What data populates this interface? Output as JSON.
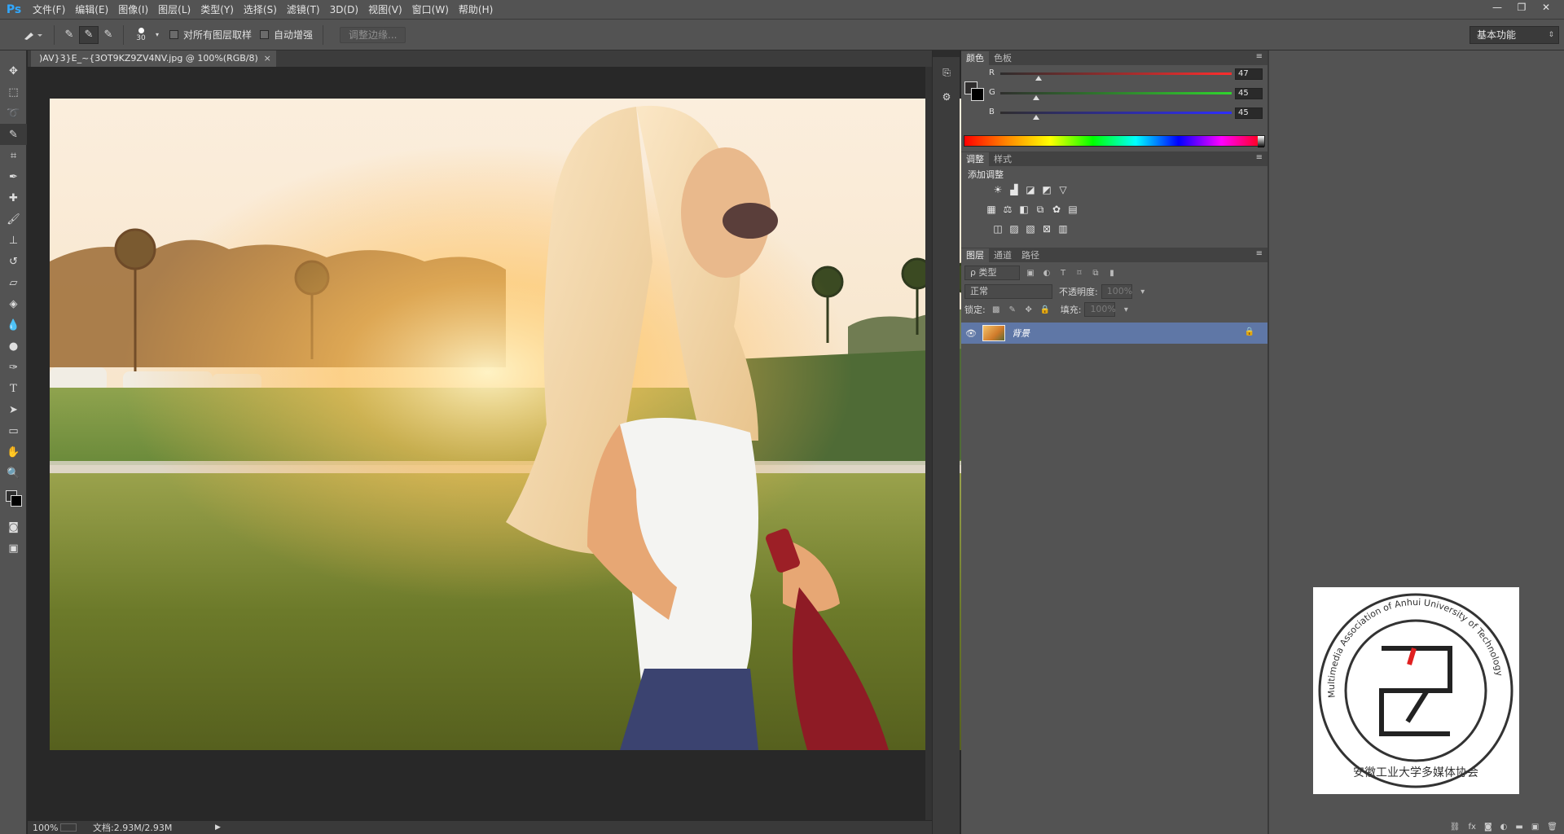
{
  "app": {
    "logo": "Ps"
  },
  "menu": [
    "文件(F)",
    "编辑(E)",
    "图像(I)",
    "图层(L)",
    "类型(Y)",
    "选择(S)",
    "滤镜(T)",
    "3D(D)",
    "视图(V)",
    "窗口(W)",
    "帮助(H)"
  ],
  "window_controls": {
    "minimize": "—",
    "restore": "❐",
    "close": "✕"
  },
  "options": {
    "brush_size": "30",
    "sample_all_layers": "对所有图层取样",
    "auto_enhance": "自动增强",
    "refine_edge": "调整边缘...",
    "workspace": "基本功能"
  },
  "document": {
    "tab_title": ")AV}3}E_~{3OT9KZ9ZV4NV.jpg @ 100%(RGB/8)",
    "tab_close": "×",
    "zoom": "100%",
    "doc_size": "文档:2.93M/2.93M"
  },
  "color_panel": {
    "tabs": [
      "颜色",
      "色板"
    ],
    "r_label": "R",
    "r_value": "47",
    "g_label": "G",
    "g_value": "45",
    "b_label": "B",
    "b_value": "45",
    "fg_color": "#2f2d2d"
  },
  "adjust_panel": {
    "tabs": [
      "调整",
      "样式"
    ],
    "title": "添加调整"
  },
  "layers_panel": {
    "tabs": [
      "图层",
      "通道",
      "路径"
    ],
    "filter_kind": "ρ 类型",
    "blend_mode": "正常",
    "opacity_label": "不透明度:",
    "opacity_value": "100%",
    "lock_label": "锁定:",
    "fill_label": "填充:",
    "fill_value": "100%",
    "layers": [
      {
        "name": "背景",
        "visible": true,
        "locked": true
      }
    ]
  },
  "watermark": {
    "outer_text": "Multimedia Association of Anhui University of Technology",
    "inner_text": "安徽工业大学多媒体协会"
  }
}
